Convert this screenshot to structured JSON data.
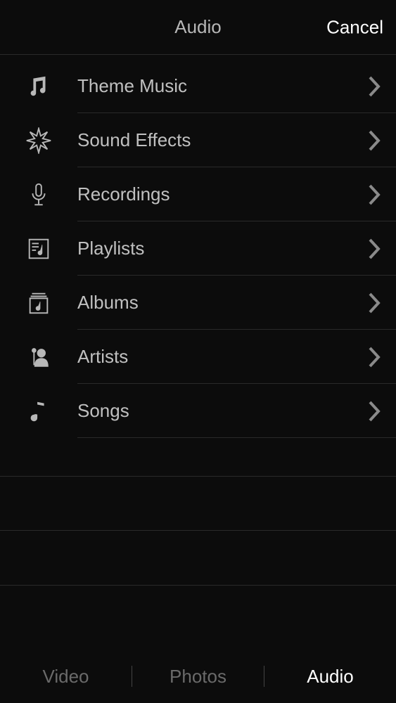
{
  "header": {
    "title": "Audio",
    "cancel": "Cancel"
  },
  "items": [
    {
      "id": "theme-music",
      "label": "Theme Music",
      "icon": "music-notes"
    },
    {
      "id": "sound-effects",
      "label": "Sound Effects",
      "icon": "burst"
    },
    {
      "id": "recordings",
      "label": "Recordings",
      "icon": "microphone"
    },
    {
      "id": "playlists",
      "label": "Playlists",
      "icon": "playlist"
    },
    {
      "id": "albums",
      "label": "Albums",
      "icon": "albums"
    },
    {
      "id": "artists",
      "label": "Artists",
      "icon": "artist"
    },
    {
      "id": "songs",
      "label": "Songs",
      "icon": "song"
    }
  ],
  "toolbar": {
    "video": "Video",
    "photos": "Photos",
    "audio": "Audio",
    "active": "audio"
  }
}
